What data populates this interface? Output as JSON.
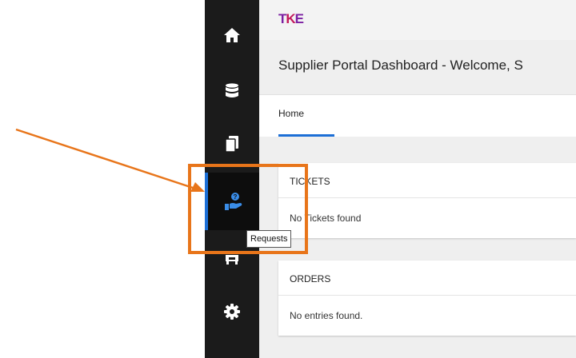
{
  "brand": {
    "logo_text_a": "T",
    "logo_text_b": "K",
    "logo_text_c": "E"
  },
  "sidebar": {
    "items": [
      {
        "icon": "home-icon"
      },
      {
        "icon": "database-icon"
      },
      {
        "icon": "documents-icon"
      },
      {
        "icon": "requests-icon",
        "active": true
      },
      {
        "icon": "store-icon"
      },
      {
        "icon": "gear-icon"
      }
    ],
    "tooltip": "Requests"
  },
  "header": {
    "title": "Supplier Portal Dashboard - Welcome, S"
  },
  "tabs": [
    {
      "label": "Home",
      "active": true
    }
  ],
  "cards": {
    "tickets": {
      "title": "TICKETS",
      "empty_text": "No Tickets found"
    },
    "orders": {
      "title": "ORDERS",
      "empty_text": "No entries found."
    }
  },
  "colors": {
    "accent": "#1c6fd6",
    "annotation": "#e8751a",
    "sidebar_bg": "#1b1b1b"
  }
}
